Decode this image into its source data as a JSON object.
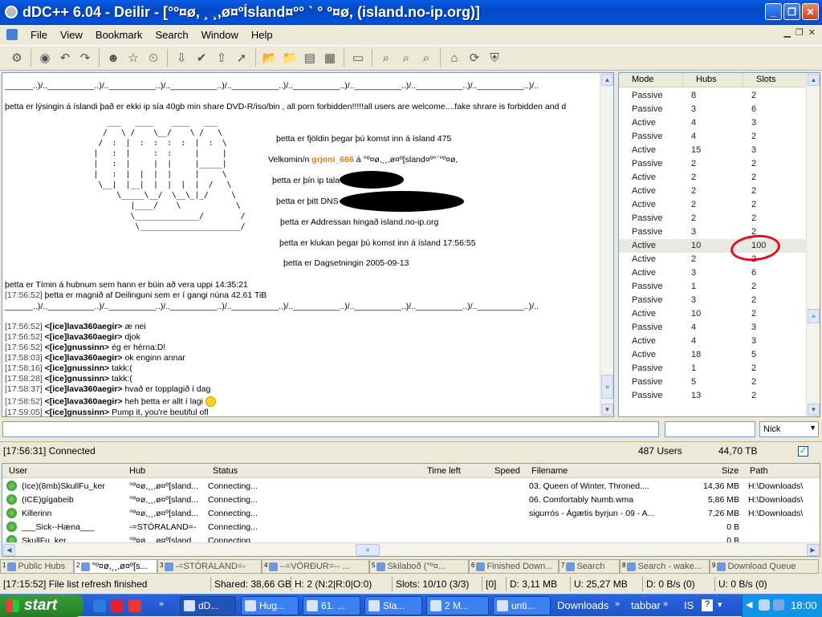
{
  "window": {
    "title": "dDC++ 6.04 - Deilir - [°º¤ø, ¸ ¸,ø¤ºÍsland¤º° ` ° º¤ø, (island.no-ip.org)]"
  },
  "menu": [
    "File",
    "View",
    "Bookmark",
    "Search",
    "Window",
    "Help"
  ],
  "chat": {
    "separator": "______..)/..__________..)/..__________..)/..__________..)/..__________..)/..__________..)/..__________..)/..__________..)/..__________..)/..",
    "description": "þetta er lýsingin á íslandi það er ekki ip sía 40gb min share DVD-R/iso/bin , all porn forbidden!!!!!all users are welcome....fake shrare is forbidden and d",
    "info": {
      "users_label": "þetta er fjöldin þegar þú komst inn á ísland 475",
      "welcome_prefix": "Velkomin/n",
      "welcome_nick": "grjoni_666",
      "welcome_suffix": "á °º¤ø,¸¸,ø¤º[sland¤º°`°º¤ø,",
      "ip_label": "þetta er þín ip tala",
      "dns_label": "þetta er þitt DNS",
      "address_label": "þetta er Addressan hingað  island.no-ip.org",
      "clock_label": "þetta er klukan þegar þú komst inn á ísland 17:56:55",
      "date_label": "þetta er Dagsetningin 2005-09-13"
    },
    "uptime": "þetta er Tímin á hubnum sem hann er búin að vera uppi 14:35:21",
    "share_ts": "[17:56:52]",
    "share": "þetta er magnið af Deilinguni sem er í gangi núna 42.61 TiB",
    "messages": [
      {
        "ts": "[17:56:52]",
        "nick": "<[ice]lava360aegir>",
        "text": "æ nei"
      },
      {
        "ts": "[17:56:52]",
        "nick": "<[ice]lava360aegir>",
        "text": "djok"
      },
      {
        "ts": "[17:56:52]",
        "nick": "<[ice]gnussinn>",
        "text": "ég er hérna:D!"
      },
      {
        "ts": "[17:58:03]",
        "nick": "<[ice]lava360aegir>",
        "text": "ok enginn annar"
      },
      {
        "ts": "[17:58:16]",
        "nick": "<[ice]gnussinn>",
        "text": "takk:("
      },
      {
        "ts": "[17:58:28]",
        "nick": "<[ice]gnussinn>",
        "text": "takk:("
      },
      {
        "ts": "[17:58:37]",
        "nick": "<[ice]lava360aegir>",
        "text": "hvað er topplagið í dag"
      },
      {
        "ts": "[17:58:52]",
        "nick": "<[ice]lava360aegir>",
        "text": "heh þetta er allt í lagi"
      },
      {
        "ts": "[17:59:05]",
        "nick": "<[ice]gnussinn>",
        "text": "Pump it, you're beutiful ofl"
      }
    ]
  },
  "userlist": {
    "headers": [
      "Mode",
      "Hubs",
      "Slots"
    ],
    "rows": [
      [
        "Passive",
        "8",
        "2"
      ],
      [
        "Passive",
        "3",
        "6"
      ],
      [
        "Active",
        "4",
        "3"
      ],
      [
        "Passive",
        "4",
        "2"
      ],
      [
        "Active",
        "15",
        "3"
      ],
      [
        "Passive",
        "2",
        "2"
      ],
      [
        "Active",
        "2",
        "2"
      ],
      [
        "Active",
        "2",
        "2"
      ],
      [
        "Active",
        "2",
        "2"
      ],
      [
        "Passive",
        "2",
        "2"
      ],
      [
        "Passive",
        "3",
        "2"
      ],
      [
        "Active",
        "10",
        "100"
      ],
      [
        "Active",
        "2",
        "2"
      ],
      [
        "Active",
        "3",
        "6"
      ],
      [
        "Passive",
        "1",
        "2"
      ],
      [
        "Passive",
        "3",
        "2"
      ],
      [
        "Active",
        "10",
        "2"
      ],
      [
        "Passive",
        "4",
        "3"
      ],
      [
        "Active",
        "4",
        "3"
      ],
      [
        "Active",
        "18",
        "5"
      ],
      [
        "Passive",
        "1",
        "2"
      ],
      [
        "Passive",
        "5",
        "2"
      ],
      [
        "Passive",
        "13",
        "2"
      ]
    ],
    "highlight_color": "#e0101a"
  },
  "nick_dropdown": "Nick",
  "status": {
    "connected": "[17:56:31] Connected",
    "users": "487 Users",
    "share": "44,70 TB",
    "checkbox": "✓"
  },
  "transfers": {
    "headers": [
      "User",
      "Hub",
      "Status",
      "Time left",
      "Speed",
      "Filename",
      "Size",
      "Path"
    ],
    "rows": [
      {
        "user": "(Ice)(8mb)SkullFu_ker",
        "hub": "°º¤ø,¸¸,ø¤º[sland...",
        "status": "Connecting...",
        "file": "03. Queen of Winter, Throned....",
        "size": "14,36 MB",
        "path": "H:\\Downloads\\"
      },
      {
        "user": "(ICE)gígabeib",
        "hub": "°º¤ø,¸¸,ø¤º[sland...",
        "status": "Connecting...",
        "file": "06. Comfortably Numb.wma",
        "size": "5,86 MB",
        "path": "H:\\Downloads\\"
      },
      {
        "user": "Killerinn",
        "hub": "°º¤ø,¸¸,ø¤º[sland...",
        "status": "Connecting...",
        "file": "sigurrós - Ágætis byrjun - 09 - A...",
        "size": "7,26 MB",
        "path": "H:\\Downloads\\"
      },
      {
        "user": "___Sick--Hæna___",
        "hub": "-=STÓRALAND=-",
        "status": "Connecting...",
        "file": "",
        "size": "0 B",
        "path": ""
      },
      {
        "user": "SkullFu_ker",
        "hub": "°º¤ø,¸¸,ø¤º[sland...",
        "status": "Connecting...",
        "file": "",
        "size": "0 B",
        "path": ""
      }
    ]
  },
  "tabs": [
    {
      "n": "1",
      "label": "Public Hubs"
    },
    {
      "n": "2",
      "label": "°º¤ø,¸¸,ø¤º[s..."
    },
    {
      "n": "3",
      "label": "-=STÓRALAND=-"
    },
    {
      "n": "4",
      "label": "--=VÖRÐUR=-- ..."
    },
    {
      "n": "5",
      "label": "Skilaboð (°º¤..."
    },
    {
      "n": "6",
      "label": "Finished Down..."
    },
    {
      "n": "7",
      "label": "Search"
    },
    {
      "n": "8",
      "label": "Search - wake..."
    },
    {
      "n": "9",
      "label": "Download Queue"
    }
  ],
  "bottom_status": {
    "msg": "[17:15:52] File list refresh finished",
    "shared": "Shared: 38,66 GB",
    "hubs": "H: 2 (N:2|R:0|O:0)",
    "slots": "Slots: 10/10 (3/3)",
    "d": "[0]",
    "dl": "D: 3,11 MB",
    "ul": "U: 25,27 MB",
    "dspeed": "D: 0 B/s (0)",
    "uspeed": "U: 0 B/s (0)"
  },
  "taskbar": {
    "start": "start",
    "buttons": [
      "dD...",
      "Hug...",
      "61. ...",
      "Sla...",
      "2 M...",
      "unti..."
    ],
    "downloads": "Downloads",
    "tabbar": "tabbar",
    "lang": "IS",
    "clock": "18:00"
  }
}
